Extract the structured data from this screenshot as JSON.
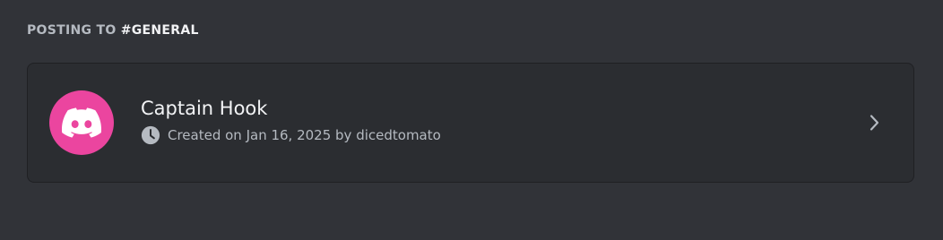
{
  "section": {
    "prefix": "POSTING TO ",
    "channel": "#GENERAL"
  },
  "card": {
    "name": "Captain Hook",
    "meta": "Created on Jan 16, 2025 by dicedtomato",
    "avatar_icon": "discord-logo-icon",
    "avatar_color": "#eb459f",
    "clock_icon": "clock-icon",
    "chevron_icon": "chevron-right-icon"
  }
}
